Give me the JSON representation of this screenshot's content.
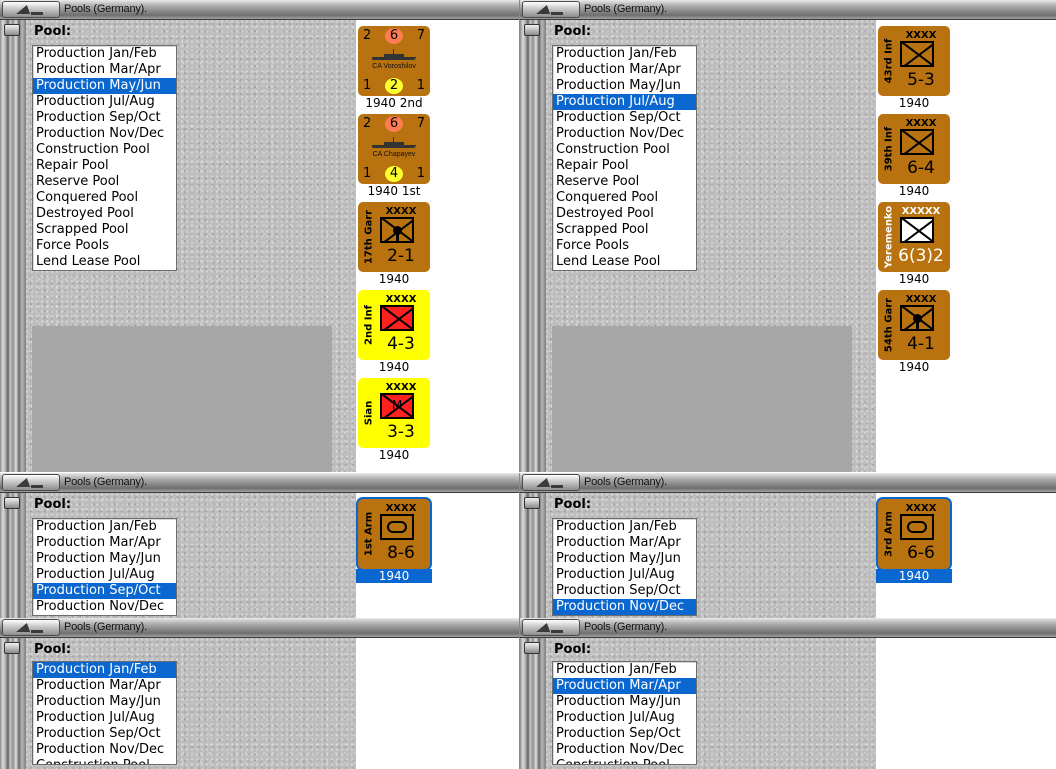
{
  "window_title": "Pools (Germany).",
  "pool_label": "Pool:",
  "pool_options": [
    "Production Jan/Feb",
    "Production Mar/Apr",
    "Production May/Jun",
    "Production Jul/Aug",
    "Production Sep/Oct",
    "Production Nov/Dec",
    "Construction Pool",
    "Repair Pool",
    "Reserve Pool",
    "Conquered Pool",
    "Destroyed Pool",
    "Scrapped Pool",
    "Force Pools",
    "Lend Lease Pool"
  ],
  "panels": [
    {
      "selected": "Production May/Jun",
      "units": [
        {
          "kind": "ship",
          "top_left": "2",
          "top_center": "6",
          "top_right": "7",
          "name": "CA Voroshilov",
          "bottom_left": "1",
          "bottom_center": "2",
          "bottom_right": "1",
          "year": "1940 2nd"
        },
        {
          "kind": "ship",
          "top_left": "2",
          "top_center": "6",
          "top_right": "7",
          "name": "CA Chapayev",
          "bottom_left": "1",
          "bottom_center": "4",
          "bottom_right": "1",
          "year": "1940 1st"
        },
        {
          "kind": "land",
          "color": "brown",
          "type": "garrison",
          "name": "17th Garr",
          "size": "XXXX",
          "strength": "2-1",
          "year": "1940"
        },
        {
          "kind": "land",
          "color": "yellow",
          "type": "infantry",
          "symbol": "red",
          "name": "2nd Inf",
          "size": "XXXX",
          "strength": "4-3",
          "year": "1940"
        },
        {
          "kind": "land",
          "color": "yellow",
          "type": "mountain",
          "symbol": "red",
          "mark": "M",
          "name": "Sian",
          "size": "XXXX",
          "strength": "3-3",
          "year": "1940"
        }
      ]
    },
    {
      "selected": "Production Jul/Aug",
      "units": [
        {
          "kind": "land",
          "color": "brown",
          "type": "infantry",
          "name": "43rd Inf",
          "size": "XXXX",
          "strength": "5-3",
          "year": "1940"
        },
        {
          "kind": "land",
          "color": "brown",
          "type": "infantry",
          "name": "39th Inf",
          "size": "XXXX",
          "strength": "6-4",
          "year": "1940"
        },
        {
          "kind": "land",
          "color": "brown",
          "type": "infantry",
          "symbol": "white",
          "name": "Yeremenko",
          "size": "XXXXX",
          "strength": "6(3)2",
          "year": "1940",
          "white_text": true
        },
        {
          "kind": "land",
          "color": "brown",
          "type": "garrison",
          "name": "54th Garr",
          "size": "XXXX",
          "strength": "4-1",
          "year": "1940"
        }
      ]
    },
    {
      "selected": "Production Sep/Oct",
      "units": [
        {
          "kind": "land",
          "color": "brown",
          "type": "armor",
          "name": "1st Arm",
          "size": "XXXX",
          "strength": "8-6",
          "year": "1940",
          "selected": true
        }
      ]
    },
    {
      "selected": "Production Nov/Dec",
      "units": [
        {
          "kind": "land",
          "color": "brown",
          "type": "armor",
          "name": "3rd Arm",
          "size": "XXXX",
          "strength": "6-6",
          "year": "1940",
          "selected": true
        }
      ]
    },
    {
      "selected": "Production Jan/Feb",
      "units": []
    },
    {
      "selected": "Production Mar/Apr",
      "units": []
    }
  ],
  "colors": {
    "counter_brown": "#b8720f",
    "counter_yellow": "#ffff00",
    "selection": "#0a67cf",
    "symbol_red": "#ff2020"
  },
  "icons": {
    "title_button": "window-menu-icon",
    "side_knob": "scroll-handle-icon"
  }
}
